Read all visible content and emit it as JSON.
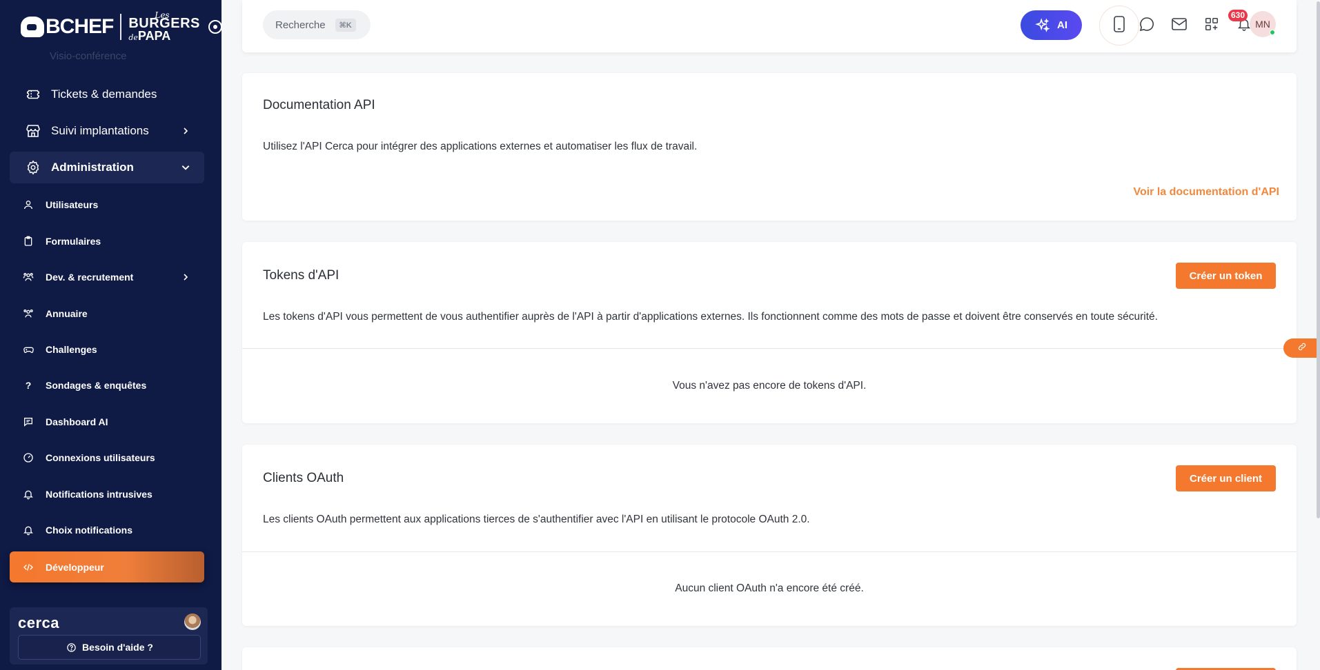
{
  "sidebar": {
    "brand": {
      "chef": "BCHEF",
      "les": "Les",
      "burgers": "BURGERS",
      "de": "de",
      "papa": "PAPA"
    },
    "partial_item": "Visio-conférence",
    "main_items": [
      {
        "label": "Tickets & demandes",
        "icon": "ticket-icon"
      },
      {
        "label": "Suivi implantations",
        "icon": "store-icon"
      },
      {
        "label": "Administration",
        "icon": "gear-icon"
      }
    ],
    "sub_items": [
      {
        "label": "Utilisateurs",
        "icon": "user-icon"
      },
      {
        "label": "Formulaires",
        "icon": "clipboard-icon"
      },
      {
        "label": "Dev. & recrutement",
        "icon": "people-icon"
      },
      {
        "label": "Annuaire",
        "icon": "people-icon"
      },
      {
        "label": "Challenges",
        "icon": "gamepad-icon"
      },
      {
        "label": "Sondages & enquêtes",
        "icon": "question-icon"
      },
      {
        "label": "Dashboard AI",
        "icon": "chat-icon"
      },
      {
        "label": "Connexions utilisateurs",
        "icon": "gauge-icon"
      },
      {
        "label": "Notifications intrusives",
        "icon": "bell-icon"
      },
      {
        "label": "Choix notifications",
        "icon": "bell-icon"
      },
      {
        "label": "Développeur",
        "icon": "code-icon"
      }
    ],
    "footer": {
      "brand": "cerca",
      "help_label": "Besoin d'aide ?"
    }
  },
  "topbar": {
    "search_label": "Recherche",
    "search_shortcut": "⌘K",
    "ai_label": "AI",
    "notification_count": "630",
    "avatar_initials": "MN"
  },
  "cards": {
    "docs": {
      "title": "Documentation API",
      "description": "Utilisez l'API Cerca pour intégrer des applications externes et automatiser les flux de travail.",
      "link": "Voir la documentation d'API"
    },
    "tokens": {
      "title": "Tokens d'API",
      "button": "Créer un token",
      "description": "Les tokens d'API vous permettent de vous authentifier auprès de l'API à partir d'applications externes. Ils fonctionnent comme des mots de passe et doivent être conservés en toute sécurité.",
      "empty": "Vous n'avez pas encore de tokens d'API."
    },
    "oauth": {
      "title": "Clients OAuth",
      "button": "Créer un client",
      "description": "Les clients OAuth permettent aux applications tierces de s'authentifier avec l'API en utilisant le protocole OAuth 2.0.",
      "empty": "Aucun client OAuth n'a encore été créé."
    }
  },
  "colors": {
    "sidebar_bg": "#0f1a45",
    "accent": "#f4782d",
    "ai_gradient_start": "#3a4be0",
    "badge": "#e8384a"
  }
}
